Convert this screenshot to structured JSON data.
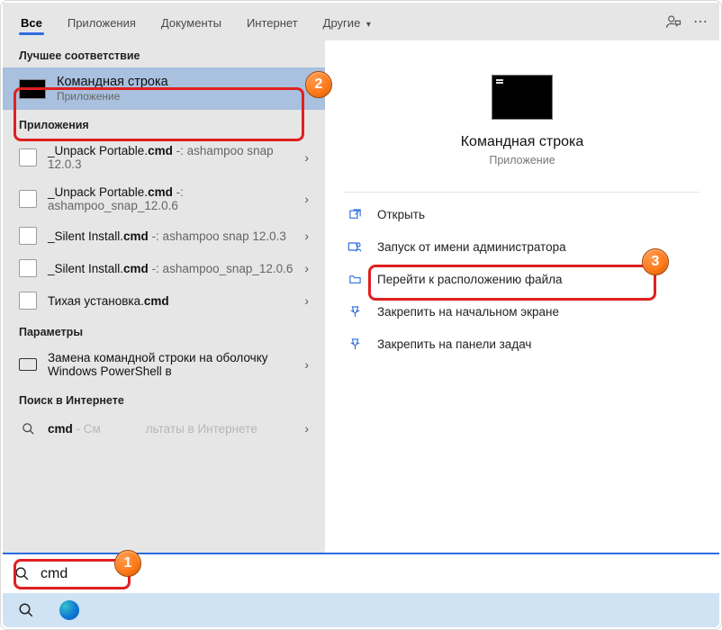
{
  "tabs": {
    "all": "Все",
    "apps": "Приложения",
    "docs": "Документы",
    "web": "Интернет",
    "more": "Другие"
  },
  "sections": {
    "best": "Лучшее соответствие",
    "apps": "Приложения",
    "settings": "Параметры",
    "web": "Поиск в Интернете"
  },
  "best": {
    "title": "Командная строка",
    "sub": "Приложение"
  },
  "app_results": [
    {
      "title_pre": "_Unpack Portable.",
      "title_bold": "cmd",
      "suffix": " -: ashampoo snap 12.0.3"
    },
    {
      "title_pre": "_Unpack Portable.",
      "title_bold": "cmd",
      "suffix": " -: ashampoo_snap_12.0.6"
    },
    {
      "title_pre": "_Silent Install.",
      "title_bold": "cmd",
      "suffix": " -: ashampoo snap 12.0.3"
    },
    {
      "title_pre": "_Silent Install.",
      "title_bold": "cmd",
      "suffix": " -: ashampoo_snap_12.0.6"
    },
    {
      "title_pre": "Тихая установка.",
      "title_bold": "cmd",
      "suffix": ""
    }
  ],
  "setting_result": "Замена командной строки на оболочку Windows PowerShell в",
  "web_result": {
    "term": "cmd",
    "trail_pre": " - См",
    "trail_post": "льтаты в Интернете"
  },
  "preview": {
    "title": "Командная строка",
    "sub": "Приложение"
  },
  "actions": {
    "open": "Открыть",
    "admin": "Запуск от имени администратора",
    "location": "Перейти к расположению файла",
    "pin_start": "Закрепить на начальном экране",
    "pin_task": "Закрепить на панели задач"
  },
  "search": {
    "value": "cmd"
  },
  "badges": {
    "b1": "1",
    "b2": "2",
    "b3": "3"
  }
}
